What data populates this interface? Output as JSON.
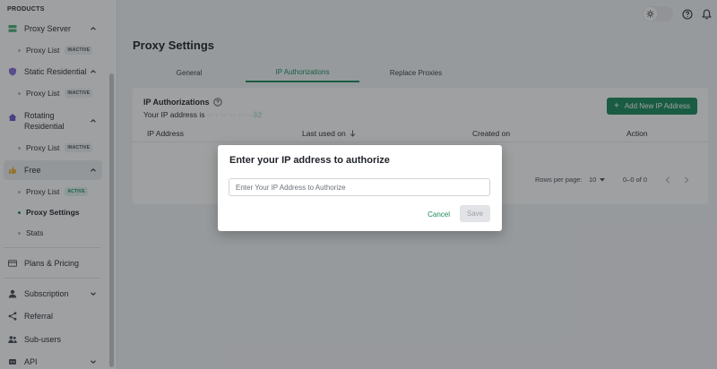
{
  "sidebar": {
    "section_label": "PRODUCTS",
    "items": [
      {
        "label": "Proxy Server",
        "icon": "server-icon"
      },
      {
        "label": "Static Residential",
        "icon": "shield-icon"
      },
      {
        "label": "Rotating Residential",
        "icon": "home-icon"
      },
      {
        "label": "Free",
        "icon": "thumb-icon"
      },
      {
        "label": "Plans & Pricing",
        "icon": "card-icon"
      },
      {
        "label": "Subscription",
        "icon": "person-icon"
      },
      {
        "label": "Referral",
        "icon": "share-icon"
      },
      {
        "label": "Sub-users",
        "icon": "users-icon"
      },
      {
        "label": "API",
        "icon": "api-icon"
      }
    ],
    "sub_items": {
      "proxy_list_1": {
        "label": "Proxy List",
        "badge": "INACTIVE"
      },
      "proxy_list_2": {
        "label": "Proxy List",
        "badge": "INACTIVE"
      },
      "proxy_list_3": {
        "label": "Proxy List",
        "badge": "INACTIVE"
      },
      "proxy_list_free": {
        "label": "Proxy List",
        "badge": "ACTIVE"
      },
      "proxy_settings": {
        "label": "Proxy Settings"
      },
      "stats": {
        "label": "Stats"
      }
    }
  },
  "page": {
    "title": "Proxy Settings",
    "tabs": [
      {
        "label": "General"
      },
      {
        "label": "IP Authorizations"
      },
      {
        "label": "Replace Proxies"
      }
    ]
  },
  "card": {
    "title": "IP Authorizations",
    "your_ip_prefix": "Your IP address is",
    "your_ip_value": "·· · ·· ·· ·····32",
    "add_button": "Add New IP Address",
    "columns": [
      "IP Address",
      "Last used on",
      "Created on",
      "Action"
    ],
    "rows_per_page_label": "Rows per page:",
    "rows_per_page_value": "10",
    "range_text": "0–0 of 0"
  },
  "dialog": {
    "title": "Enter your IP address to authorize",
    "input_placeholder": "Enter Your IP Address to Authorize",
    "input_value": "",
    "cancel_label": "Cancel",
    "save_label": "Save"
  },
  "colors": {
    "accent": "#1c8b5e",
    "overlay": "#191c20"
  }
}
